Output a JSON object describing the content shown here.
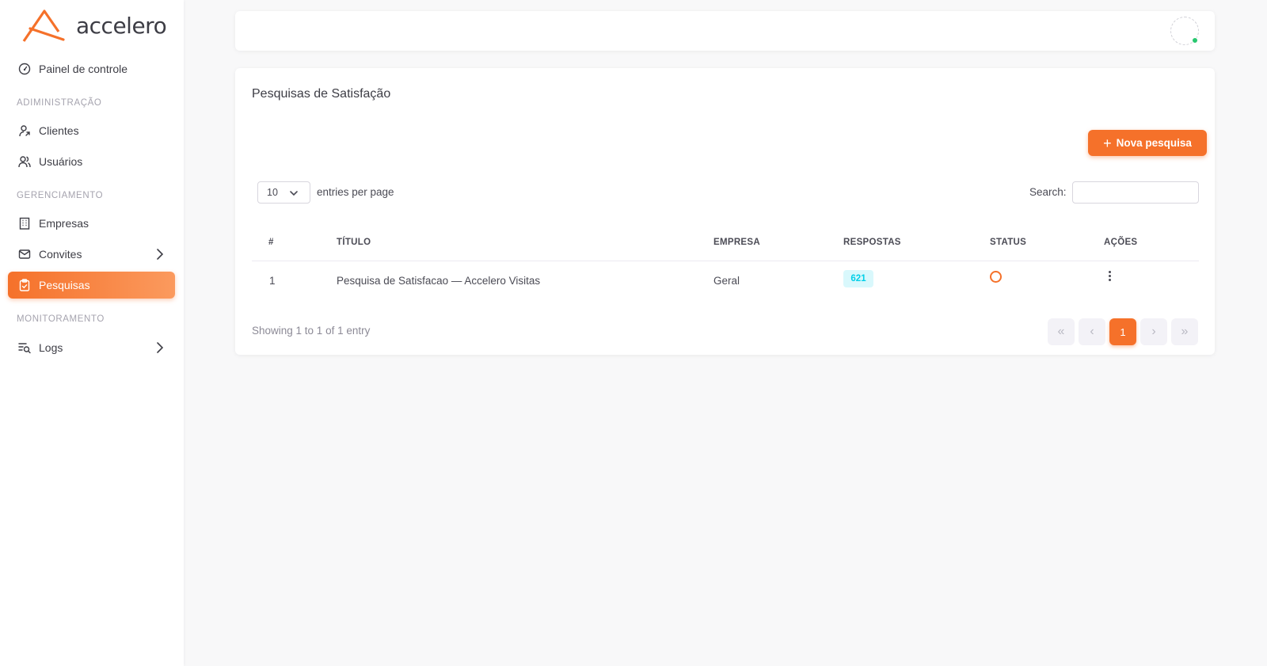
{
  "brand": {
    "name": "accelero",
    "accent": "#f5712a"
  },
  "sidebar": {
    "dashboard": {
      "label": "Painel de controle",
      "icon": "gauge-icon"
    },
    "sections": [
      {
        "label": "ADIMINISTRAÇÃO"
      },
      {
        "label": "GERENCIAMENTO"
      },
      {
        "label": "MONITORAMENTO"
      }
    ],
    "items": [
      {
        "label": "Clientes",
        "icon": "user-arrow-icon"
      },
      {
        "label": "Usuários",
        "icon": "users-icon"
      },
      {
        "label": "Empresas",
        "icon": "building-icon"
      },
      {
        "label": "Convites",
        "icon": "mail-icon",
        "expandable": true
      },
      {
        "label": "Pesquisas",
        "icon": "clipboard-check-icon",
        "active": true
      },
      {
        "label": "Logs",
        "icon": "list-search-icon",
        "expandable": true
      }
    ]
  },
  "topbar": {
    "status_color": "#28c76f"
  },
  "page": {
    "title": "Pesquisas de Satisfação",
    "new_button": "Nova pesquisa",
    "entries": {
      "value": "10",
      "label": "entries per page"
    },
    "search": {
      "label": "Search:",
      "value": ""
    },
    "table": {
      "columns": [
        "#",
        "TÍTULO",
        "EMPRESA",
        "RESPOSTAS",
        "STATUS",
        "AÇÕES"
      ],
      "rows": [
        {
          "num": "1",
          "title": "Pesquisa de Satisfacao — Accelero Visitas",
          "company": "Geral",
          "responses": "621",
          "status": "inactive"
        }
      ]
    },
    "showing": "Showing 1 to 1 of 1 entry",
    "pagination": {
      "first": "«",
      "prev": "‹",
      "current": "1",
      "next": "›",
      "last": "»"
    }
  }
}
